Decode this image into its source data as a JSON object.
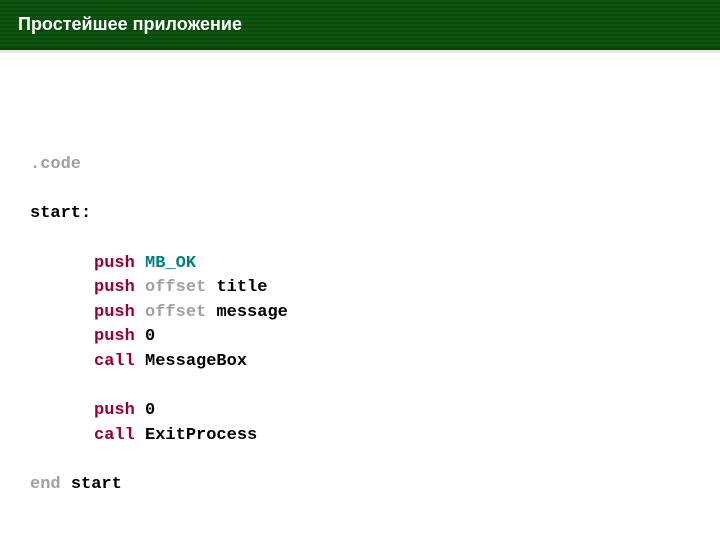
{
  "header": {
    "title": "Простейшее приложение"
  },
  "code": {
    "code_directive": ".code",
    "start_label": "start:",
    "push": "push",
    "call": "call",
    "space": " ",
    "mb_ok": "MB_OK",
    "offset": "offset",
    "title_sym": "title",
    "message_sym": "message",
    "zero": "0",
    "messagebox": "MessageBox",
    "exitprocess": "ExitProcess",
    "end": "end",
    "start_end": "start"
  }
}
